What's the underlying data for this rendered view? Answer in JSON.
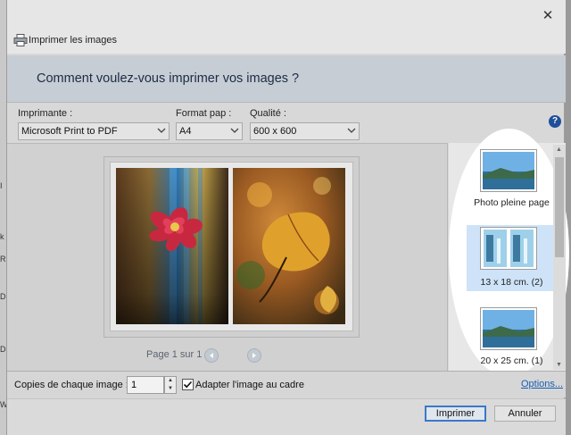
{
  "dialog": {
    "title": "Imprimer les images",
    "close_glyph": "✕",
    "heading": "Comment voulez-vous imprimer vos images ?"
  },
  "printer": {
    "label": "Imprimante :",
    "value": "Microsoft Print to PDF"
  },
  "paper": {
    "label": "Format pap :",
    "value": "A4"
  },
  "quality": {
    "label": "Qualité :",
    "value": "600 x 600"
  },
  "help_glyph": "?",
  "preview": {
    "page_info": "Page 1 sur 1"
  },
  "layouts": [
    {
      "label": "Photo pleine page",
      "selected": false
    },
    {
      "label": "13 x 18 cm. (2)",
      "selected": true
    },
    {
      "label": "20 x 25 cm. (1)",
      "selected": false
    }
  ],
  "copies": {
    "label": "Copies de chaque image :",
    "value": "1"
  },
  "fit": {
    "label": "Adapter l'image au cadre",
    "checked": true
  },
  "options_link": "Options...",
  "buttons": {
    "print": "Imprimer",
    "cancel": "Annuler"
  },
  "colors": {
    "accent": "#3c78c8",
    "heading": "#1b2c45",
    "help": "#1f4f9a",
    "link": "#1a5fb4"
  }
}
